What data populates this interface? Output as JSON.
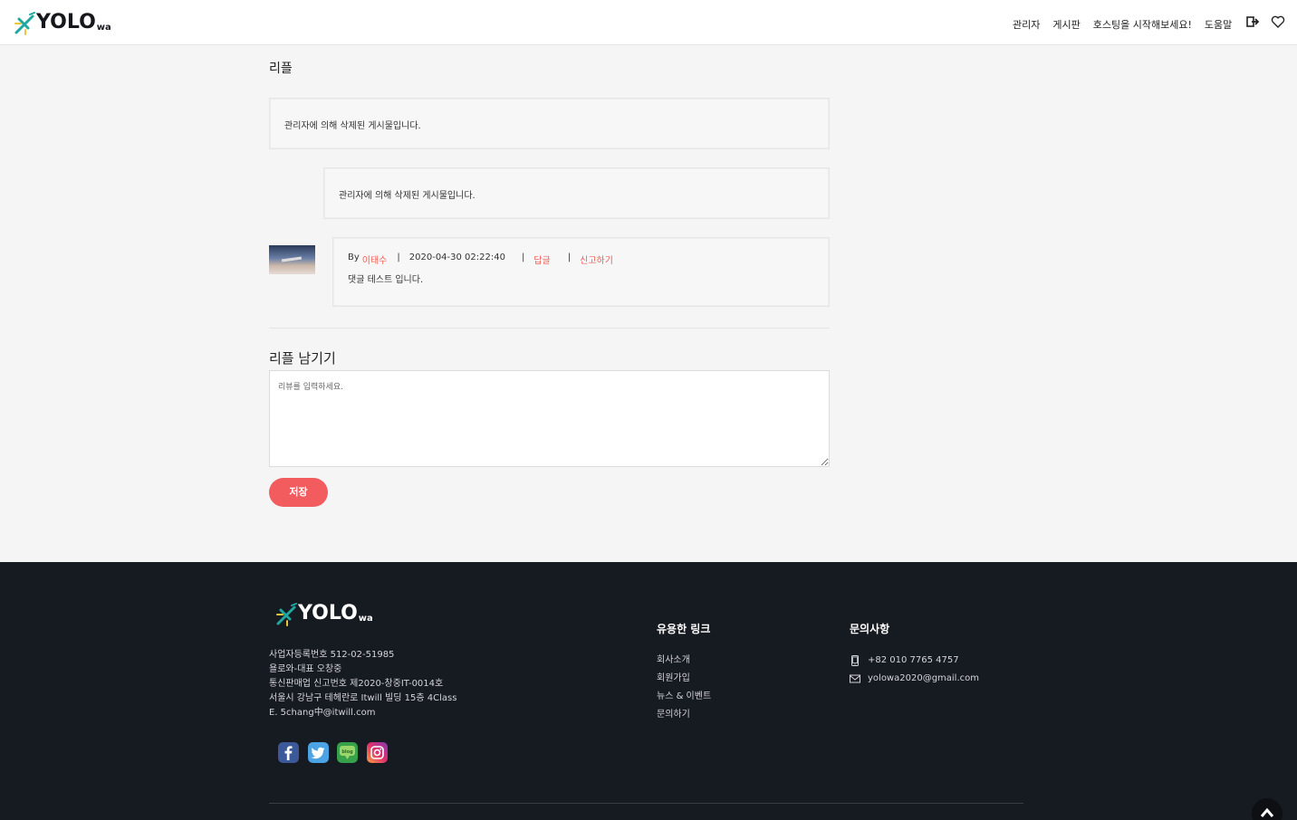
{
  "header": {
    "logo_text": "YOLO",
    "logo_sub": "wa",
    "nav": [
      "관리자",
      "게시판",
      "호스팅을 시작해보세요!",
      "도움말"
    ],
    "icons": [
      "sign-out-icon",
      "heart-icon"
    ]
  },
  "replies": {
    "title": "리플",
    "deleted_1": "관리자에 의해 삭제된 게시물입니다.",
    "deleted_2": "관리자에 의해 삭제된 게시물입니다.",
    "comment": {
      "by_label": "By",
      "author": "이태수",
      "sep": "|",
      "datetime": "2020-04-30 02:22:40",
      "reply_link": "답글",
      "report_link": "신고하기",
      "body": "댓글 테스트 입니다."
    }
  },
  "leave_reply": {
    "title": "리플 남기기",
    "placeholder": "리뷰를 입력하세요.",
    "save_label": "저장"
  },
  "footer": {
    "logo_text": "YOLO",
    "logo_sub": "wa",
    "info": [
      "사업자등록번호 512-02-51985",
      "욜로와-대표 오창중",
      "통신판매업 신고번호 제2020-창중IT-0014호",
      "서울시 강남구 테헤란로 Itwill 빌딩 15층 4Class",
      "E. 5chang中@itwill.com"
    ],
    "socials": [
      "facebook-icon",
      "twitter-icon",
      "blog-icon",
      "instagram-icon"
    ],
    "links_title": "유용한 링크",
    "links": [
      "회사소개",
      "회원가입",
      "뉴스 & 이벤트",
      "문의하기"
    ],
    "contact_title": "문의사항",
    "phone": "+82 010 7765 4757",
    "email": "yolowa2020@gmail.com"
  },
  "colors": {
    "accent": "#f25c5f",
    "footer_bg": "#161a21",
    "page_bg": "#f5f5f5"
  }
}
